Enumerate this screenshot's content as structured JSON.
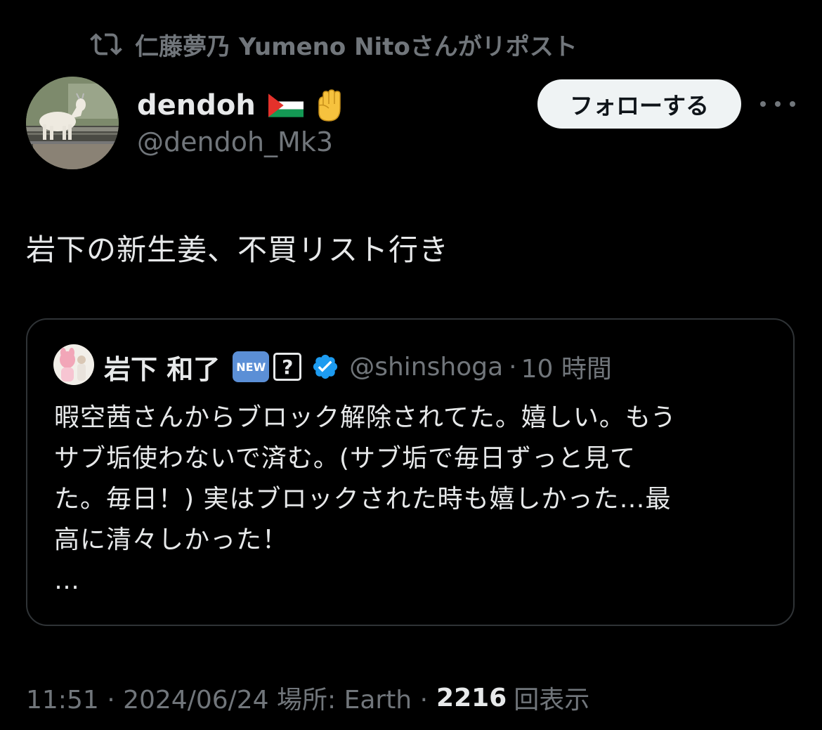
{
  "repost": {
    "text": "仁藤夢乃  Yumeno Nitoさんがリポスト",
    "icon": "repost-icon"
  },
  "author": {
    "display_name": "dendoh",
    "handle": "@dendoh_Mk3",
    "emojis": [
      "palestine-flag-icon",
      "raised-fist-icon"
    ]
  },
  "follow_label": "フォローする",
  "tweet_text": "岩下の新生姜、不買リスト行き",
  "quote": {
    "name": "岩下 和了",
    "new_badge": "NEW",
    "question_badge": "?",
    "handle": "@shinshoga",
    "separator": "·",
    "time": "10 時間",
    "lines": [
      "暇空茜さんからブロック解除されてた。嬉しい。もう",
      "サブ垢使わないで済む。(サブ垢で毎日ずっと見て",
      "た。毎日！) 実はブロックされた時も嬉しかった…最",
      "高に清々しかった！",
      "…"
    ]
  },
  "meta": {
    "time_date": "11:51 · 2024/06/24 場所: Earth ·",
    "views_count": "2216",
    "views_label": "回表示"
  },
  "colors": {
    "background": "#000000",
    "primary_text": "#e7e9ea",
    "secondary_text": "#71767b",
    "border": "#2f3336",
    "verified": "#1d9bf0"
  }
}
